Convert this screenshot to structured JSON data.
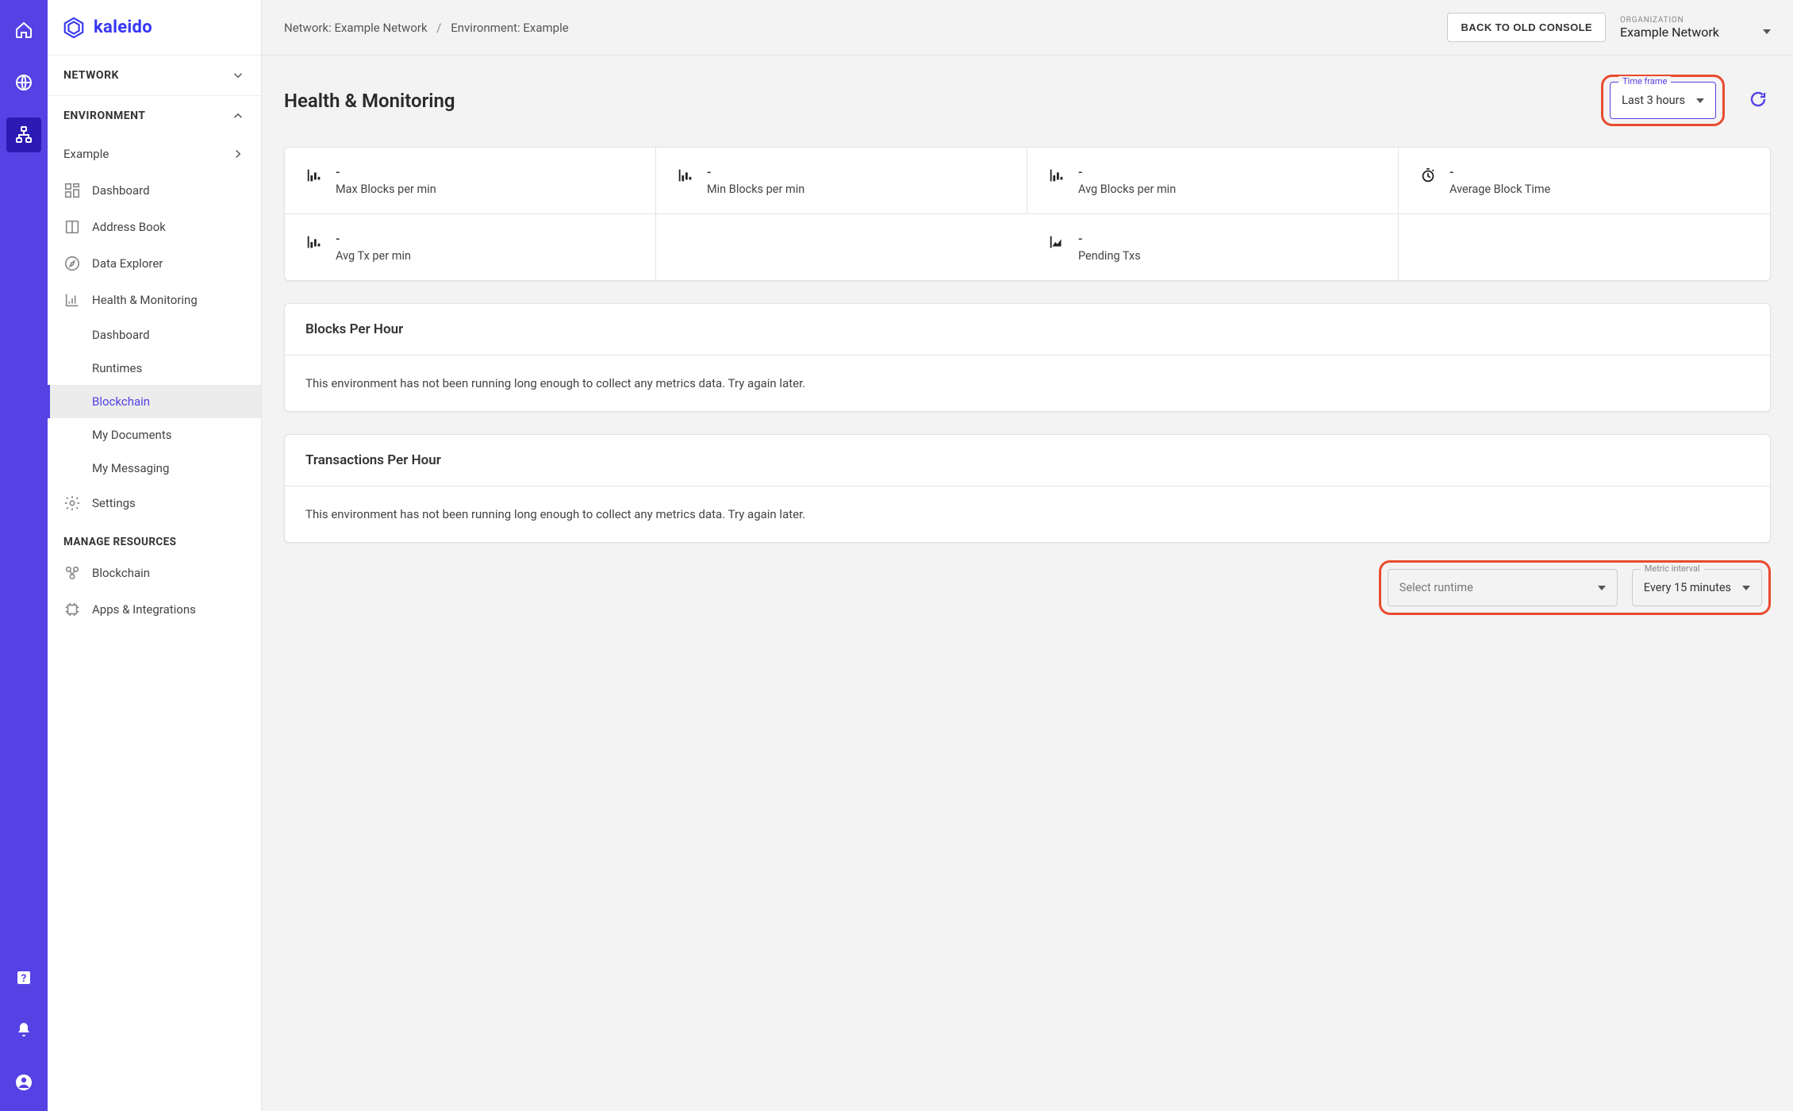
{
  "brand": {
    "name": "kaleido"
  },
  "rail": {
    "items": [
      "home",
      "globe",
      "network",
      "help",
      "bell",
      "account"
    ],
    "active": "network"
  },
  "sidebar": {
    "network_header": "NETWORK",
    "environment_header": "ENVIRONMENT",
    "env_name": "Example",
    "items": [
      {
        "key": "dashboard",
        "label": "Dashboard"
      },
      {
        "key": "address-book",
        "label": "Address Book"
      },
      {
        "key": "data-explorer",
        "label": "Data Explorer"
      },
      {
        "key": "health",
        "label": "Health & Monitoring"
      }
    ],
    "health_subitems": [
      {
        "key": "hm-dashboard",
        "label": "Dashboard"
      },
      {
        "key": "hm-runtimes",
        "label": "Runtimes"
      },
      {
        "key": "hm-blockchain",
        "label": "Blockchain",
        "active": true
      },
      {
        "key": "hm-mydocs",
        "label": "My Documents"
      },
      {
        "key": "hm-mymsg",
        "label": "My Messaging"
      }
    ],
    "settings_label": "Settings",
    "manage_header": "MANAGE RESOURCES",
    "manage_items": [
      {
        "key": "mr-blockchain",
        "label": "Blockchain"
      },
      {
        "key": "mr-apps",
        "label": "Apps & Integrations"
      }
    ]
  },
  "topbar": {
    "network_label": "Network:",
    "network_name": "Example Network",
    "env_label": "Environment:",
    "env_name": "Example",
    "back_btn": "BACK TO OLD CONSOLE",
    "org_label": "ORGANIZATION",
    "org_name": "Example Network"
  },
  "page": {
    "title": "Health & Monitoring",
    "timeframe_label": "Time frame",
    "timeframe_value": "Last 3 hours"
  },
  "stats_row1": [
    {
      "value": "-",
      "label": "Max Blocks per min",
      "icon": "bar"
    },
    {
      "value": "-",
      "label": "Min Blocks per min",
      "icon": "bar"
    },
    {
      "value": "-",
      "label": "Avg Blocks per min",
      "icon": "bar"
    },
    {
      "value": "-",
      "label": "Average Block Time",
      "icon": "timer"
    }
  ],
  "stats_row2": [
    {
      "value": "-",
      "label": "Avg Tx per min",
      "icon": "bar"
    },
    {
      "value": "",
      "label": ""
    },
    {
      "value": "-",
      "label": "Pending Txs",
      "icon": "area"
    },
    {
      "value": "",
      "label": ""
    }
  ],
  "panels": {
    "blocks_title": "Blocks Per Hour",
    "tx_title": "Transactions Per Hour",
    "empty_msg": "This environment has not been running long enough to collect any metrics data. Try again later."
  },
  "runtime_bar": {
    "runtime_label": "Select runtime",
    "interval_label": "Metric interval",
    "interval_value": "Every 15 minutes"
  }
}
